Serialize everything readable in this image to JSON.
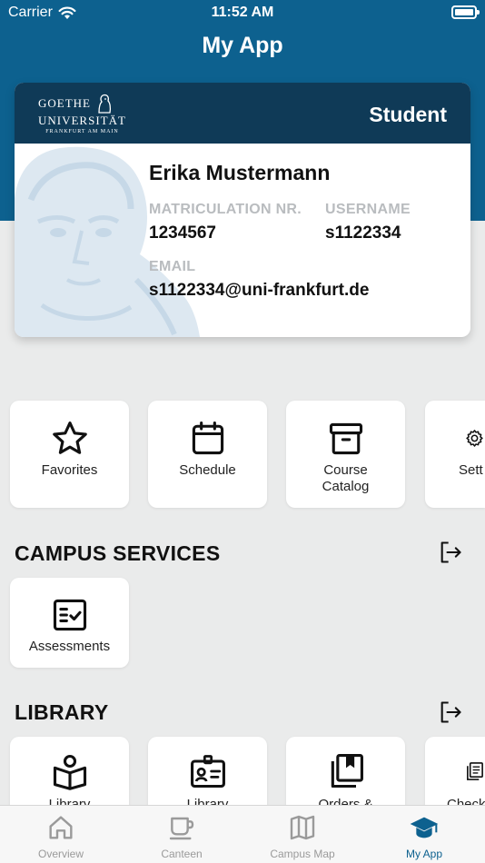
{
  "status_bar": {
    "carrier": "Carrier",
    "time": "11:52 AM"
  },
  "header": {
    "title": "My App"
  },
  "id_card": {
    "institution": {
      "line1": "GOETHE",
      "line2": "UNIVERSITÄT",
      "line3": "FRANKFURT AM MAIN"
    },
    "role": "Student",
    "name": "Erika Mustermann",
    "fields": [
      {
        "label": "MATRICULATION NR.",
        "value": "1234567"
      },
      {
        "label": "USERNAME",
        "value": "s1122334"
      },
      {
        "label": "EMAIL",
        "value": "s1122334@uni-frankfurt.de"
      }
    ]
  },
  "shortcuts": [
    {
      "label": "Favorites",
      "icon": "star-icon"
    },
    {
      "label": "Schedule",
      "icon": "calendar-icon"
    },
    {
      "label": "Course\nCatalog",
      "icon": "archive-box-icon"
    },
    {
      "label": "Sett",
      "icon": "gear-icon"
    }
  ],
  "campus_services": {
    "title": "CAMPUS SERVICES",
    "items": [
      {
        "label": "Assessments",
        "icon": "checklist-icon"
      }
    ]
  },
  "library": {
    "title": "LIBRARY",
    "items": [
      {
        "label": "Library",
        "icon": "book-reader-icon"
      },
      {
        "label": "Library",
        "icon": "id-card-icon"
      },
      {
        "label": "Orders &",
        "icon": "books-bookmark-icon"
      },
      {
        "label": "Check",
        "icon": "documents-icon"
      }
    ]
  },
  "tab_bar": {
    "tabs": [
      {
        "label": "Overview",
        "icon": "home-icon",
        "active": false
      },
      {
        "label": "Canteen",
        "icon": "coffee-cup-icon",
        "active": false
      },
      {
        "label": "Campus Map",
        "icon": "map-icon",
        "active": false
      },
      {
        "label": "My App",
        "icon": "graduation-cap-icon",
        "active": true
      }
    ]
  },
  "colors": {
    "brand_blue": "#0d618f",
    "card_header": "#0f3a57",
    "background": "#eaebeb",
    "label_gray": "#b9bcbf",
    "tab_inactive": "#9a9a9a"
  }
}
